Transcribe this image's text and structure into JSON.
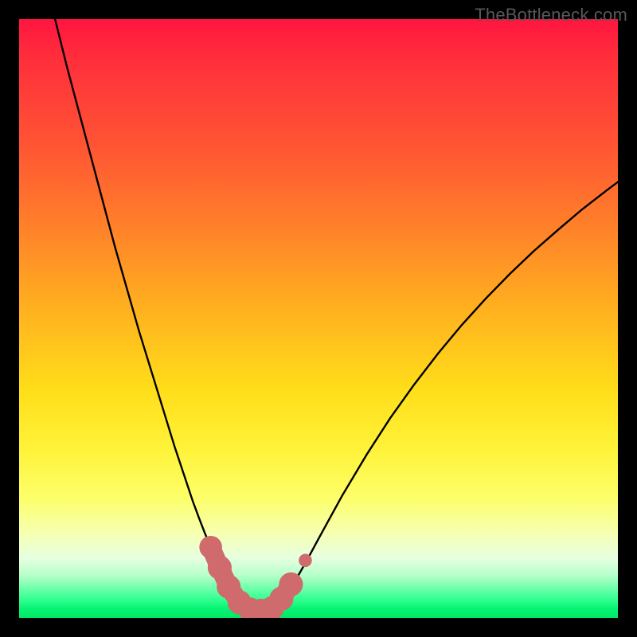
{
  "watermark": "TheBottleneck.com",
  "colors": {
    "frame": "#000000",
    "curve": "#000000",
    "marker_fill": "#cf6a6d",
    "marker_stroke": "#b95457"
  },
  "chart_data": {
    "type": "line",
    "title": "",
    "xlabel": "",
    "ylabel": "",
    "xlim": [
      0,
      100
    ],
    "ylim": [
      0,
      100
    ],
    "grid": false,
    "series": [
      {
        "name": "curve",
        "x": [
          6,
          8,
          10,
          12,
          14,
          16,
          18,
          20,
          22,
          24,
          26,
          28,
          29,
          30,
          31,
          32,
          33,
          34,
          35,
          36,
          37,
          38,
          39,
          40,
          42,
          44,
          46,
          48,
          50,
          54,
          58,
          62,
          66,
          70,
          74,
          78,
          82,
          86,
          90,
          94,
          98,
          100
        ],
        "y": [
          100,
          92,
          84.5,
          77,
          69.5,
          62,
          55,
          48,
          41.5,
          35,
          28.5,
          22.5,
          19.5,
          16.8,
          14.2,
          11.8,
          9.6,
          7.5,
          5.6,
          4.0,
          2.7,
          1.8,
          1.2,
          1.0,
          1.2,
          3.0,
          6.0,
          9.5,
          13.2,
          20.5,
          27.2,
          33.4,
          39.0,
          44.2,
          49.0,
          53.4,
          57.5,
          61.3,
          64.8,
          68.2,
          71.3,
          72.8
        ]
      }
    ],
    "markers": [
      {
        "name": "marker-left-edge",
        "x": 32.0,
        "y": 11.8,
        "r": 1.9
      },
      {
        "name": "marker-left-mid",
        "x": 33.5,
        "y": 8.4,
        "r": 2.0
      },
      {
        "name": "marker-left-inner",
        "x": 35.0,
        "y": 5.2,
        "r": 2.0
      },
      {
        "name": "marker-trough-left",
        "x": 36.8,
        "y": 2.6,
        "r": 2.0
      },
      {
        "name": "marker-trough-center",
        "x": 38.6,
        "y": 1.4,
        "r": 2.0
      },
      {
        "name": "marker-trough-right",
        "x": 40.4,
        "y": 1.2,
        "r": 2.0
      },
      {
        "name": "marker-right-inner",
        "x": 42.2,
        "y": 1.6,
        "r": 2.0
      },
      {
        "name": "marker-right-mid",
        "x": 43.8,
        "y": 3.2,
        "r": 2.0
      },
      {
        "name": "marker-right-edge",
        "x": 45.4,
        "y": 5.6,
        "r": 2.0
      },
      {
        "name": "marker-detached",
        "x": 47.8,
        "y": 9.6,
        "r": 1.1
      }
    ]
  }
}
